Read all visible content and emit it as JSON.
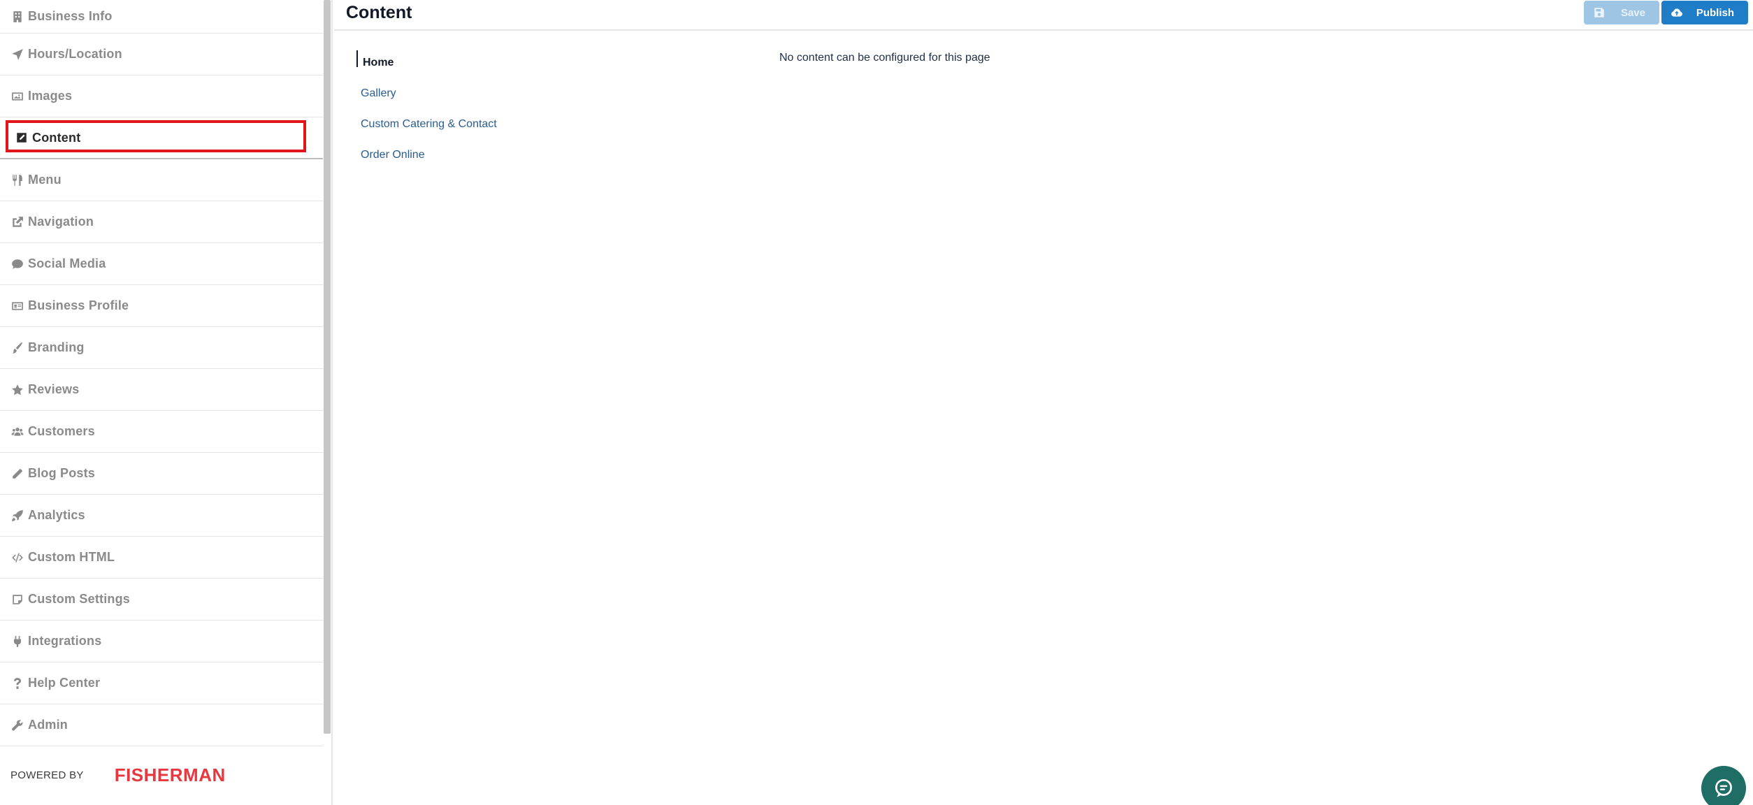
{
  "sidebar": {
    "items": [
      {
        "label": "Business Info",
        "icon": "building-icon"
      },
      {
        "label": "Hours/Location",
        "icon": "location-arrow-icon"
      },
      {
        "label": "Images",
        "icon": "image-icon"
      },
      {
        "label": "Content",
        "icon": "edit-square-icon",
        "active": true
      },
      {
        "label": "Menu",
        "icon": "utensils-icon"
      },
      {
        "label": "Navigation",
        "icon": "external-link-icon"
      },
      {
        "label": "Social Media",
        "icon": "comment-icon"
      },
      {
        "label": "Business Profile",
        "icon": "id-card-icon"
      },
      {
        "label": "Branding",
        "icon": "paint-brush-icon"
      },
      {
        "label": "Reviews",
        "icon": "star-icon"
      },
      {
        "label": "Customers",
        "icon": "users-icon"
      },
      {
        "label": "Blog Posts",
        "icon": "pencil-icon"
      },
      {
        "label": "Analytics",
        "icon": "rocket-icon"
      },
      {
        "label": "Custom HTML",
        "icon": "code-icon"
      },
      {
        "label": "Custom Settings",
        "icon": "sticky-note-icon"
      },
      {
        "label": "Integrations",
        "icon": "plug-icon"
      },
      {
        "label": "Help Center",
        "icon": "question-icon"
      },
      {
        "label": "Admin",
        "icon": "wrench-icon"
      }
    ],
    "powered_by": "POWERED BY",
    "logo_text": "FISHERMAN"
  },
  "header": {
    "title": "Content",
    "save_label": "Save",
    "publish_label": "Publish"
  },
  "page_nav": {
    "items": [
      "Home",
      "Gallery",
      "Custom Catering & Contact",
      "Order Online"
    ],
    "active": "Home"
  },
  "main": {
    "empty_message": "No content can be configured for this page"
  },
  "colors": {
    "highlight": "#e0161c",
    "primary": "#1f7dc7",
    "primary_disabled": "#9ec5e4",
    "link": "#2a5d8f",
    "logo": "#e8373f",
    "chat": "#1f6e66"
  }
}
